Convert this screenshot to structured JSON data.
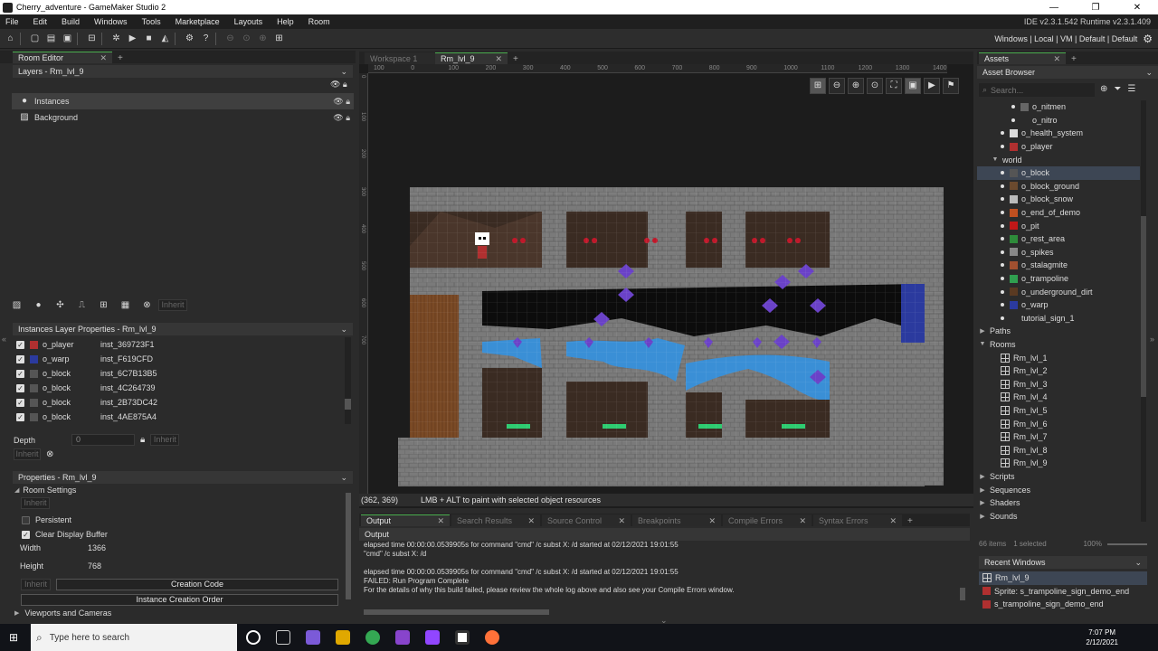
{
  "window": {
    "title": "Cherry_adventure - GameMaker Studio 2",
    "minimize": "—",
    "maximize": "❐",
    "close": "✕"
  },
  "menu": {
    "items": [
      "File",
      "Edit",
      "Build",
      "Windows",
      "Tools",
      "Marketplace",
      "Layouts",
      "Help",
      "Room"
    ],
    "version": "IDE v2.3.1.542  Runtime v2.3.1.409"
  },
  "toolbar": {
    "targets": "Windows | Local | VM | Default | Default"
  },
  "room_editor": {
    "tab": "Room Editor",
    "layers_header": "Layers - Rm_lvl_9",
    "layers": [
      {
        "name": "Instances",
        "icon": "instances-icon"
      },
      {
        "name": "Background",
        "icon": "background-icon"
      }
    ],
    "layer_tools_inherit": "Inherit",
    "instances_header": "Instances Layer Properties - Rm_lvl_9",
    "instances": [
      {
        "object": "o_player",
        "id": "inst_369723F1",
        "color": "#b03030"
      },
      {
        "object": "o_warp",
        "id": "inst_F619CFD",
        "color": "#2b3a9e"
      },
      {
        "object": "o_block",
        "id": "inst_6C7B13B5",
        "color": "#555555"
      },
      {
        "object": "o_block",
        "id": "inst_4C264739",
        "color": "#555555"
      },
      {
        "object": "o_block",
        "id": "inst_2B73DC42",
        "color": "#555555"
      },
      {
        "object": "o_block",
        "id": "inst_4AE875A4",
        "color": "#555555"
      }
    ],
    "depth_label": "Depth",
    "depth_value": "0",
    "inherit": "Inherit",
    "properties_header": "Properties - Rm_lvl_9",
    "room_settings": "Room Settings",
    "persistent": "Persistent",
    "clear_display_buffer": "Clear Display Buffer",
    "width_label": "Width",
    "width_value": "1366",
    "height_label": "Height",
    "height_value": "768",
    "creation_code": "Creation Code",
    "instance_creation_order": "Instance Creation Order",
    "viewports": "Viewports and Cameras"
  },
  "workspace": {
    "tabs": [
      {
        "label": "Workspace 1",
        "active": false
      },
      {
        "label": "Rm_lvl_9",
        "active": true
      }
    ],
    "ruler_h": [
      "100",
      "0",
      "100",
      "200",
      "300",
      "400",
      "500",
      "600",
      "700",
      "800",
      "900",
      "1000",
      "1100",
      "1200",
      "1300",
      "1400"
    ],
    "ruler_v": [
      "0",
      "100",
      "200",
      "300",
      "400",
      "500",
      "600",
      "700"
    ],
    "coords": "(362, 369)",
    "hint": "LMB + ALT to paint with selected object resources"
  },
  "output": {
    "tabs": [
      "Output",
      "Search Results",
      "Source Control",
      "Breakpoints",
      "Compile Errors",
      "Syntax Errors"
    ],
    "header": "Output",
    "lines": [
      "elapsed time 00:00:00.0539905s for command \"cmd\" /c subst X: /d started at 02/12/2021 19:01:55",
      "\"cmd\" /c subst X: /d",
      "",
      "elapsed time 00:00:00.0539905s for command \"cmd\" /c subst X: /d started at 02/12/2021 19:01:55",
      "FAILED: Run Program Complete",
      "For the details of why this build failed, please review the whole log above and also see your Compile Errors window."
    ]
  },
  "assets": {
    "tab": "Assets",
    "browser": "Asset Browser",
    "search_placeholder": "Search...",
    "tree": [
      {
        "label": "o_nitmen",
        "indent": 2,
        "kind": "obj",
        "color": "#666"
      },
      {
        "label": "o_nitro",
        "indent": 2,
        "kind": "obj",
        "color": ""
      },
      {
        "label": "o_health_system",
        "indent": 1,
        "kind": "obj",
        "color": "#ddd"
      },
      {
        "label": "o_player",
        "indent": 1,
        "kind": "obj",
        "color": "#b03030"
      },
      {
        "label": "world",
        "indent": 0,
        "kind": "folder",
        "color": ""
      },
      {
        "label": "o_block",
        "indent": 1,
        "kind": "obj",
        "color": "#555",
        "selected": true
      },
      {
        "label": "o_block_ground",
        "indent": 1,
        "kind": "obj",
        "color": "#6b4a2e"
      },
      {
        "label": "o_block_snow",
        "indent": 1,
        "kind": "obj",
        "color": "#bbb"
      },
      {
        "label": "o_end_of_demo",
        "indent": 1,
        "kind": "obj",
        "color": "#c05020"
      },
      {
        "label": "o_pit",
        "indent": 1,
        "kind": "obj",
        "color": "#c01818"
      },
      {
        "label": "o_rest_area",
        "indent": 1,
        "kind": "obj",
        "color": "#2e8b3a"
      },
      {
        "label": "o_spikes",
        "indent": 1,
        "kind": "obj",
        "color": "#888"
      },
      {
        "label": "o_stalagmite",
        "indent": 1,
        "kind": "obj",
        "color": "#a05030"
      },
      {
        "label": "o_trampoline",
        "indent": 1,
        "kind": "obj",
        "color": "#30a050"
      },
      {
        "label": "o_underground_dirt",
        "indent": 1,
        "kind": "obj",
        "color": "#5a3a22"
      },
      {
        "label": "o_warp",
        "indent": 1,
        "kind": "obj",
        "color": "#2b3a9e"
      },
      {
        "label": "tutorial_sign_1",
        "indent": 1,
        "kind": "obj",
        "color": ""
      },
      {
        "label": "Paths",
        "indent": -1,
        "kind": "group",
        "color": ""
      },
      {
        "label": "Rooms",
        "indent": -1,
        "kind": "group-open",
        "color": ""
      },
      {
        "label": "Rm_lvl_1",
        "indent": 1,
        "kind": "room",
        "color": ""
      },
      {
        "label": "Rm_lvl_2",
        "indent": 1,
        "kind": "room",
        "color": ""
      },
      {
        "label": "Rm_lvl_3",
        "indent": 1,
        "kind": "room",
        "color": ""
      },
      {
        "label": "Rm_lvl_4",
        "indent": 1,
        "kind": "room",
        "color": ""
      },
      {
        "label": "Rm_lvl_5",
        "indent": 1,
        "kind": "room",
        "color": ""
      },
      {
        "label": "Rm_lvl_6",
        "indent": 1,
        "kind": "room",
        "color": ""
      },
      {
        "label": "Rm_lvl_7",
        "indent": 1,
        "kind": "room",
        "color": ""
      },
      {
        "label": "Rm_lvl_8",
        "indent": 1,
        "kind": "room",
        "color": ""
      },
      {
        "label": "Rm_lvl_9",
        "indent": 1,
        "kind": "room",
        "color": ""
      },
      {
        "label": "Scripts",
        "indent": -1,
        "kind": "group",
        "color": ""
      },
      {
        "label": "Sequences",
        "indent": -1,
        "kind": "group",
        "color": ""
      },
      {
        "label": "Shaders",
        "indent": -1,
        "kind": "group",
        "color": ""
      },
      {
        "label": "Sounds",
        "indent": -1,
        "kind": "group",
        "color": ""
      }
    ],
    "count": "66 items",
    "selected_count": "1 selected",
    "zoom": "100%",
    "recent_header": "Recent Windows",
    "recent": [
      "Rm_lvl_9",
      "Sprite: s_trampoline_sign_demo_end",
      "s_trampoline_sign_demo_end"
    ]
  },
  "taskbar": {
    "search_placeholder": "Type here to search",
    "time": "7:07 PM",
    "date": "2/12/2021"
  }
}
